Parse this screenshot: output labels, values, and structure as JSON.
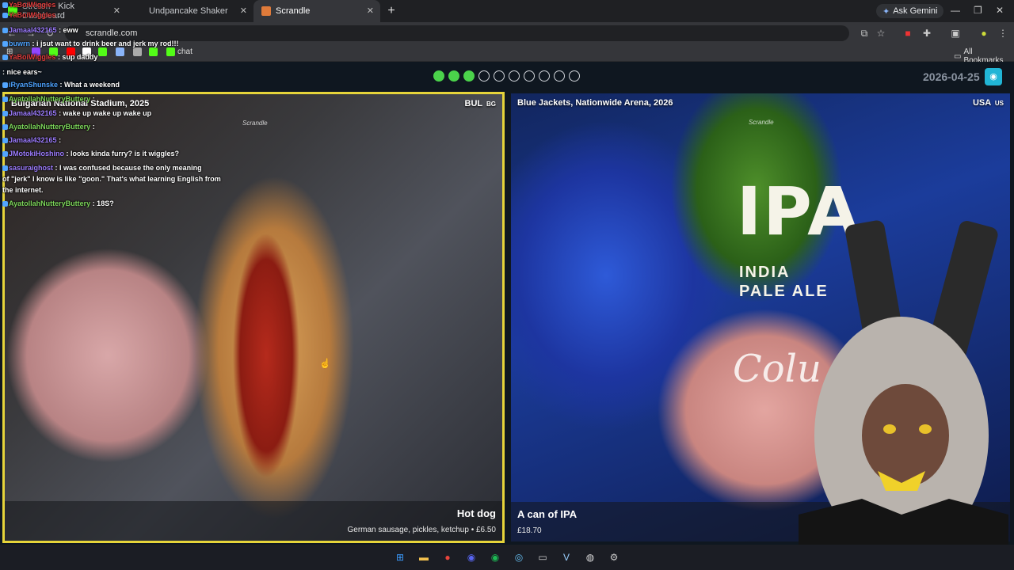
{
  "browser": {
    "tabs": [
      {
        "title": "Stream - Kick Dashboard",
        "icon": "kick-icon",
        "color": "#53fc18",
        "active": false
      },
      {
        "title": "Undpancake Shaker",
        "icon": "page-icon",
        "color": "#444",
        "active": false
      },
      {
        "title": "Scrandle",
        "icon": "scrandle-icon",
        "color": "#e07b3a",
        "active": true
      }
    ],
    "ask_gemini": "Ask Gemini",
    "url": "scrandle.com",
    "bookmarks": [
      {
        "label": "",
        "color": "#9146ff"
      },
      {
        "label": "",
        "color": "#53fc18"
      },
      {
        "label": "",
        "color": "#ff0000"
      },
      {
        "label": "",
        "color": "#ffffff"
      },
      {
        "label": "",
        "color": "#53fc18"
      },
      {
        "label": "",
        "color": "#8ab4f8"
      },
      {
        "label": "",
        "color": "#aaa"
      },
      {
        "label": "",
        "color": "#53fc18"
      },
      {
        "label": "chat",
        "color": "#53fc18"
      }
    ],
    "all_bookmarks": "All Bookmarks"
  },
  "game": {
    "progress_total": 10,
    "progress_done": 3,
    "date": "2026-04-25",
    "left": {
      "venue": "Bulgarian National Stadium, 2025",
      "country": "BUL",
      "flag": "BG",
      "watermark": "Scrandle",
      "name": "Hot dog",
      "detail": "German sausage, pickles, ketchup • £6.50"
    },
    "right": {
      "venue": "Blue Jackets, Nationwide Arena, 2026",
      "country": "USA",
      "flag": "US",
      "watermark": "Scrandle",
      "name": "A can of IPA",
      "detail": "£18.70",
      "can_big": "IPA",
      "can_line1": "INDIA",
      "can_line2": "PALE ALE",
      "koozie": "Colu"
    }
  },
  "chat": [
    {
      "user": "YaBoiWiggles",
      "msg": "",
      "color": "#e03c3c"
    },
    {
      "user": "YaBoiWiggles",
      "msg": ":",
      "color": "#e03c3c"
    },
    {
      "user": "Jamaal432165",
      "msg": ": eww",
      "color": "#9d7cff"
    },
    {
      "user": "buwrn",
      "msg": ": i jsut want to drink beer and jerk my rod!!!",
      "color": "#4da3ff"
    },
    {
      "user": "YaBoiWiggles",
      "msg": ": sup daddy",
      "color": "#e03c3c"
    },
    {
      "user": "",
      "msg": ": nice ears~",
      "color": "#e03c3c"
    },
    {
      "user": "iRyanShunske",
      "msg": ": What a weekend",
      "color": "#4da3ff"
    },
    {
      "user": "AyatollahNutteryButtery",
      "msg": ":",
      "color": "#7cd65a"
    },
    {
      "user": "Jamaal432165",
      "msg": ": wake up wake up wake up",
      "color": "#9d7cff"
    },
    {
      "user": "AyatollahNutteryButtery",
      "msg": ":",
      "color": "#7cd65a"
    },
    {
      "user": "Jamaal432165",
      "msg": ":",
      "color": "#9d7cff"
    },
    {
      "user": "JMotokiHoshino",
      "msg": ": looks kinda furry? is it wiggles?",
      "color": "#9d7cff"
    },
    {
      "user": "sasuraighost",
      "msg": ": I was confused because the only meaning",
      "color": "#9d7cff"
    },
    {
      "user": "",
      "msg": "of \"jerk\" I know is like \"goon.\" That's what learning English from",
      "color": "#fff"
    },
    {
      "user": "",
      "msg": "the internet.",
      "color": "#fff"
    },
    {
      "user": "AyatollahNutteryButtery",
      "msg": ": 18S?",
      "color": "#7cd65a"
    }
  ],
  "taskbar": [
    {
      "name": "windows-start-icon",
      "glyph": "⊞",
      "color": "#3b9cff"
    },
    {
      "name": "file-explorer-icon",
      "glyph": "▬",
      "color": "#f2c14e"
    },
    {
      "name": "chrome-icon",
      "glyph": "●",
      "color": "#e8453c"
    },
    {
      "name": "discord-icon",
      "glyph": "◉",
      "color": "#5865f2"
    },
    {
      "name": "spotify-icon",
      "glyph": "◉",
      "color": "#1db954"
    },
    {
      "name": "steam-icon",
      "glyph": "◎",
      "color": "#66c0f4"
    },
    {
      "name": "terminal-icon",
      "glyph": "▭",
      "color": "#ccc"
    },
    {
      "name": "vtube-icon",
      "glyph": "V",
      "color": "#9ad0ff"
    },
    {
      "name": "obs-icon",
      "glyph": "◍",
      "color": "#ddd"
    },
    {
      "name": "settings-icon",
      "glyph": "⚙",
      "color": "#ccc"
    }
  ]
}
